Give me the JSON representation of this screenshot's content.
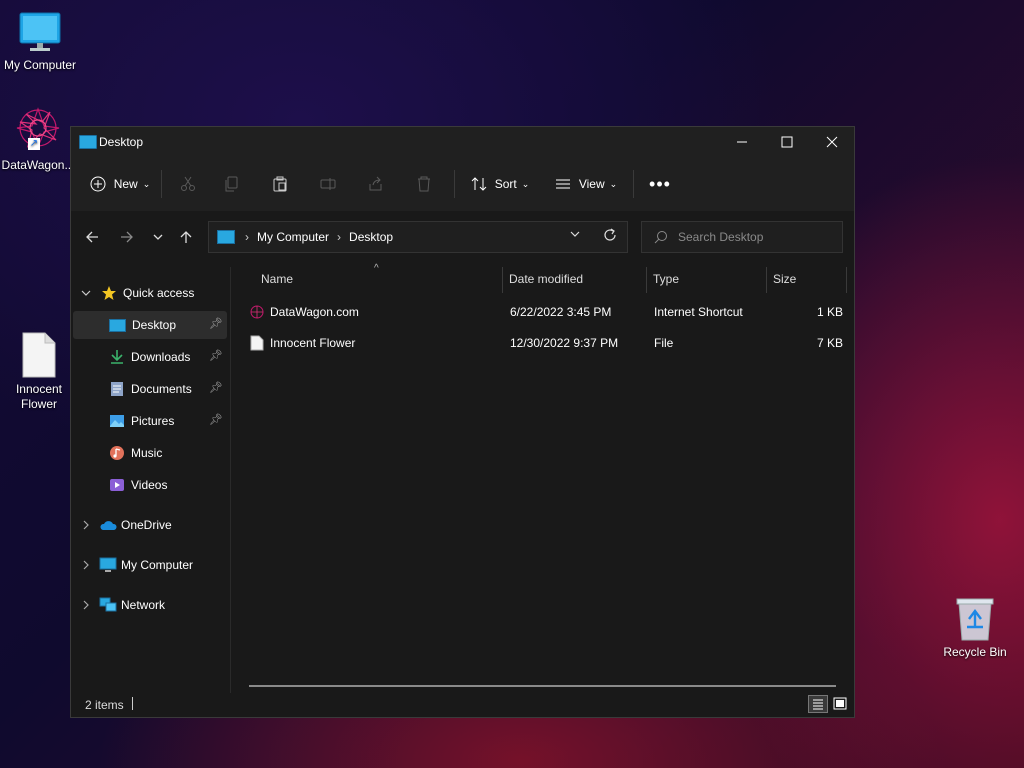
{
  "desktop": {
    "icons": [
      {
        "label": "My Computer"
      },
      {
        "label": "DataWagon..."
      },
      {
        "label": "Innocent\nFlower"
      },
      {
        "label": "Recycle Bin"
      }
    ]
  },
  "window": {
    "title": "Desktop",
    "toolbar": {
      "new_label": "New",
      "sort_label": "Sort",
      "view_label": "View"
    },
    "address": {
      "crumbs": [
        "My Computer",
        "Desktop"
      ]
    },
    "search": {
      "placeholder": "Search Desktop"
    },
    "sidebar": {
      "quick_access": "Quick access",
      "items": [
        {
          "label": "Desktop",
          "pinned": true
        },
        {
          "label": "Downloads",
          "pinned": true
        },
        {
          "label": "Documents",
          "pinned": true
        },
        {
          "label": "Pictures",
          "pinned": true
        },
        {
          "label": "Music",
          "pinned": false
        },
        {
          "label": "Videos",
          "pinned": false
        }
      ],
      "roots": [
        {
          "label": "OneDrive"
        },
        {
          "label": "My Computer"
        },
        {
          "label": "Network"
        }
      ]
    },
    "columns": {
      "name": "Name",
      "date": "Date modified",
      "type": "Type",
      "size": "Size"
    },
    "files": [
      {
        "name": "DataWagon.com",
        "date": "6/22/2022 3:45 PM",
        "type": "Internet Shortcut",
        "size": "1 KB"
      },
      {
        "name": "Innocent Flower",
        "date": "12/30/2022 9:37 PM",
        "type": "File",
        "size": "7 KB"
      }
    ],
    "status": {
      "count": "2 items"
    }
  },
  "colors": {
    "window_bg": "#191919",
    "toolbar_bg": "#202020",
    "accent": "#29a8e0",
    "star": "#f3c623"
  }
}
